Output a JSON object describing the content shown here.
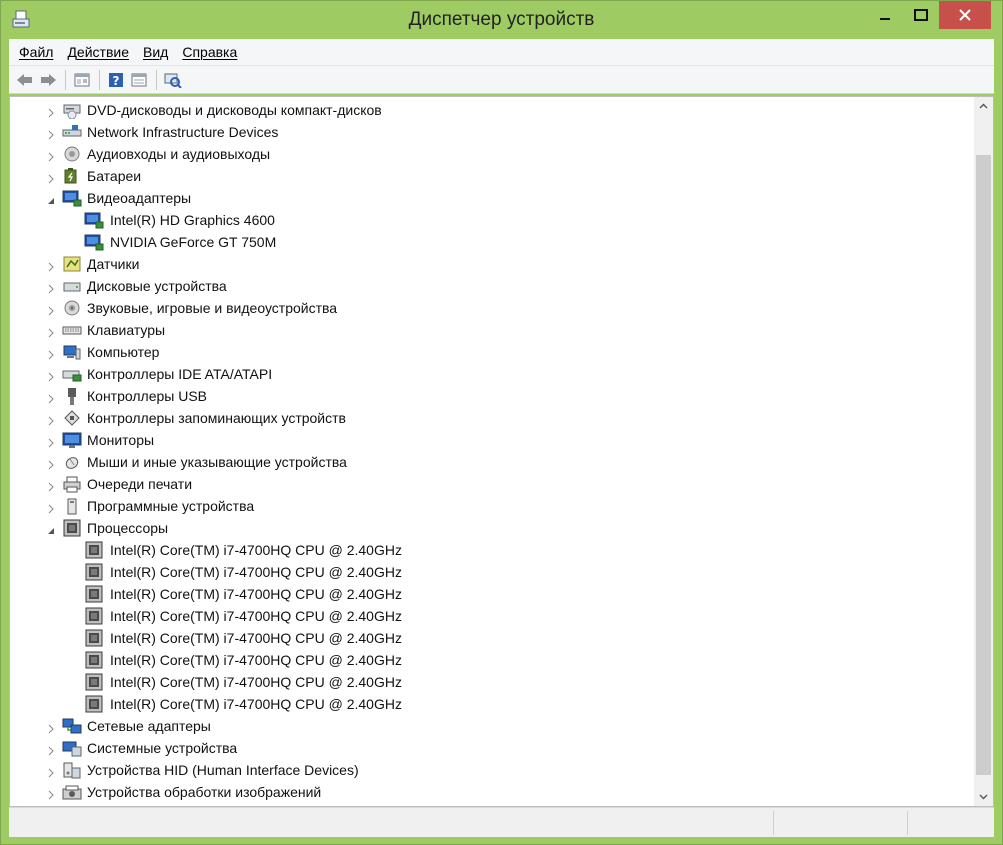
{
  "window": {
    "title": "Диспетчер устройств",
    "accent_color": "#9fcb63",
    "close_color": "#c7504b",
    "icon": "device-manager-icon"
  },
  "menu": [
    {
      "first": "Ф",
      "rest": "айл"
    },
    {
      "first": "Д",
      "rest": "ействие"
    },
    {
      "first": "В",
      "rest": "ид"
    },
    {
      "first": "С",
      "rest": "правка"
    }
  ],
  "toolbar": [
    "back-icon",
    "forward-icon",
    "properties-icon",
    "help-icon",
    "view-icon",
    "scan-hardware-icon"
  ],
  "tree": [
    {
      "label": "DVD-дисководы и дисководы компакт-дисков",
      "icon": "dvd-drive-icon",
      "expanded": false,
      "level": 0
    },
    {
      "label": "Network Infrastructure Devices",
      "icon": "network-device-icon",
      "expanded": false,
      "level": 0
    },
    {
      "label": "Аудиовходы и аудиовыходы",
      "icon": "audio-icon",
      "expanded": false,
      "level": 0
    },
    {
      "label": "Батареи",
      "icon": "battery-icon",
      "expanded": false,
      "level": 0
    },
    {
      "label": "Видеоадаптеры",
      "icon": "display-adapter-icon",
      "expanded": true,
      "level": 0
    },
    {
      "label": "Intel(R) HD Graphics 4600",
      "icon": "display-adapter-icon",
      "level": 1
    },
    {
      "label": "NVIDIA GeForce GT 750M",
      "icon": "display-adapter-icon",
      "level": 1
    },
    {
      "label": "Датчики",
      "icon": "sensor-icon",
      "expanded": false,
      "level": 0
    },
    {
      "label": "Дисковые устройства",
      "icon": "disk-drive-icon",
      "expanded": false,
      "level": 0
    },
    {
      "label": "Звуковые, игровые и видеоустройства",
      "icon": "sound-icon",
      "expanded": false,
      "level": 0
    },
    {
      "label": "Клавиатуры",
      "icon": "keyboard-icon",
      "expanded": false,
      "level": 0
    },
    {
      "label": "Компьютер",
      "icon": "computer-icon",
      "expanded": false,
      "level": 0
    },
    {
      "label": "Контроллеры IDE ATA/ATAPI",
      "icon": "ide-controller-icon",
      "expanded": false,
      "level": 0
    },
    {
      "label": "Контроллеры USB",
      "icon": "usb-icon",
      "expanded": false,
      "level": 0
    },
    {
      "label": "Контроллеры запоминающих устройств",
      "icon": "storage-controller-icon",
      "expanded": false,
      "level": 0
    },
    {
      "label": "Мониторы",
      "icon": "monitor-icon",
      "expanded": false,
      "level": 0
    },
    {
      "label": "Мыши и иные указывающие устройства",
      "icon": "mouse-icon",
      "expanded": false,
      "level": 0
    },
    {
      "label": "Очереди печати",
      "icon": "printer-icon",
      "expanded": false,
      "level": 0
    },
    {
      "label": "Программные устройства",
      "icon": "software-device-icon",
      "expanded": false,
      "level": 0
    },
    {
      "label": "Процессоры",
      "icon": "processor-icon",
      "expanded": true,
      "level": 0
    },
    {
      "label": "Intel(R) Core(TM) i7-4700HQ CPU @ 2.40GHz",
      "icon": "processor-icon",
      "level": 1
    },
    {
      "label": "Intel(R) Core(TM) i7-4700HQ CPU @ 2.40GHz",
      "icon": "processor-icon",
      "level": 1
    },
    {
      "label": "Intel(R) Core(TM) i7-4700HQ CPU @ 2.40GHz",
      "icon": "processor-icon",
      "level": 1
    },
    {
      "label": "Intel(R) Core(TM) i7-4700HQ CPU @ 2.40GHz",
      "icon": "processor-icon",
      "level": 1
    },
    {
      "label": "Intel(R) Core(TM) i7-4700HQ CPU @ 2.40GHz",
      "icon": "processor-icon",
      "level": 1
    },
    {
      "label": "Intel(R) Core(TM) i7-4700HQ CPU @ 2.40GHz",
      "icon": "processor-icon",
      "level": 1
    },
    {
      "label": "Intel(R) Core(TM) i7-4700HQ CPU @ 2.40GHz",
      "icon": "processor-icon",
      "level": 1
    },
    {
      "label": "Intel(R) Core(TM) i7-4700HQ CPU @ 2.40GHz",
      "icon": "processor-icon",
      "level": 1
    },
    {
      "label": "Сетевые адаптеры",
      "icon": "network-adapter-icon",
      "expanded": false,
      "level": 0
    },
    {
      "label": "Системные устройства",
      "icon": "system-device-icon",
      "expanded": false,
      "level": 0
    },
    {
      "label": "Устройства HID (Human Interface Devices)",
      "icon": "hid-icon",
      "expanded": false,
      "level": 0
    },
    {
      "label": "Устройства обработки изображений",
      "icon": "imaging-device-icon",
      "expanded": false,
      "level": 0
    }
  ]
}
